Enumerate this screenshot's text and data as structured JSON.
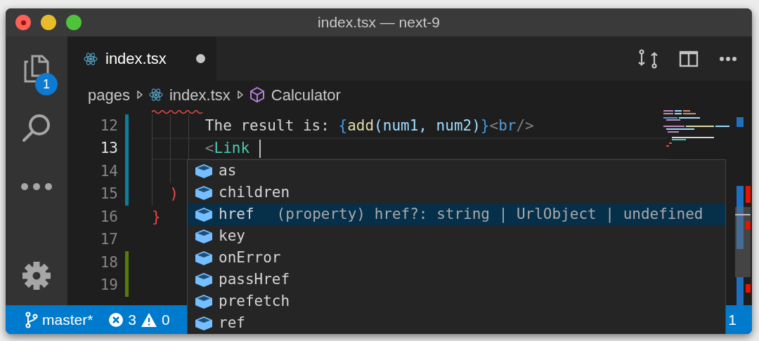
{
  "window": {
    "title": "index.tsx — next-9"
  },
  "activity_bar": [
    {
      "kind": "explorer",
      "badge": "1"
    },
    {
      "kind": "search"
    },
    {
      "kind": "more"
    },
    {
      "kind": "settings"
    }
  ],
  "tabs": [
    {
      "label": "index.tsx",
      "dirty": true,
      "selected": true
    }
  ],
  "breadcrumb": [
    {
      "label": "pages",
      "kind": "folder"
    },
    {
      "label": "index.tsx",
      "kind": "file"
    },
    {
      "label": "Calculator",
      "kind": "class"
    }
  ],
  "lines": [
    {
      "number": "12",
      "modified": true,
      "added": false,
      "current": false,
      "tokens": [
        {
          "text": "      The result is: ",
          "kind": "text"
        },
        {
          "text": "{",
          "kind": "brace"
        },
        {
          "text": "add",
          "kind": "function"
        },
        {
          "text": "(num1, num2)",
          "kind": "variable"
        },
        {
          "text": "}",
          "kind": "brace"
        },
        {
          "text": "<",
          "kind": "punct"
        },
        {
          "text": "br",
          "kind": "tag"
        },
        {
          "text": "/>",
          "kind": "punct"
        }
      ]
    },
    {
      "number": "13",
      "modified": true,
      "added": false,
      "current": true,
      "tokens": [
        {
          "text": "      <",
          "kind": "punct"
        },
        {
          "text": "Link",
          "kind": "component"
        }
      ]
    },
    {
      "number": "14",
      "modified": true,
      "added": false,
      "current": false
    },
    {
      "number": "15",
      "modified": true,
      "added": false,
      "current": false,
      "tokens": [
        {
          "text": "  )",
          "kind": "error"
        }
      ]
    },
    {
      "number": "16",
      "modified": false,
      "added": false,
      "current": false,
      "tokens": [
        {
          "text": "}",
          "kind": "error"
        }
      ]
    },
    {
      "number": "17",
      "modified": false,
      "added": false,
      "current": false
    },
    {
      "number": "18",
      "modified": false,
      "added": true,
      "current": false
    },
    {
      "number": "19",
      "modified": false,
      "added": true,
      "current": false
    }
  ],
  "suggestions": [
    {
      "label": "as",
      "kind": "property",
      "selected": false
    },
    {
      "label": "children",
      "kind": "property",
      "selected": false
    },
    {
      "label": "href",
      "kind": "property",
      "selected": true,
      "detail": "(property) href?: string | UrlObject | undefined"
    },
    {
      "label": "key",
      "kind": "property",
      "selected": false
    },
    {
      "label": "onError",
      "kind": "property",
      "selected": false
    },
    {
      "label": "passHref",
      "kind": "property",
      "selected": false
    },
    {
      "label": "prefetch",
      "kind": "property",
      "selected": false
    },
    {
      "label": "ref",
      "kind": "property",
      "selected": false
    }
  ],
  "status_bar": {
    "branch": "master*",
    "errors": "3",
    "warnings": "0",
    "right_item": "1"
  }
}
